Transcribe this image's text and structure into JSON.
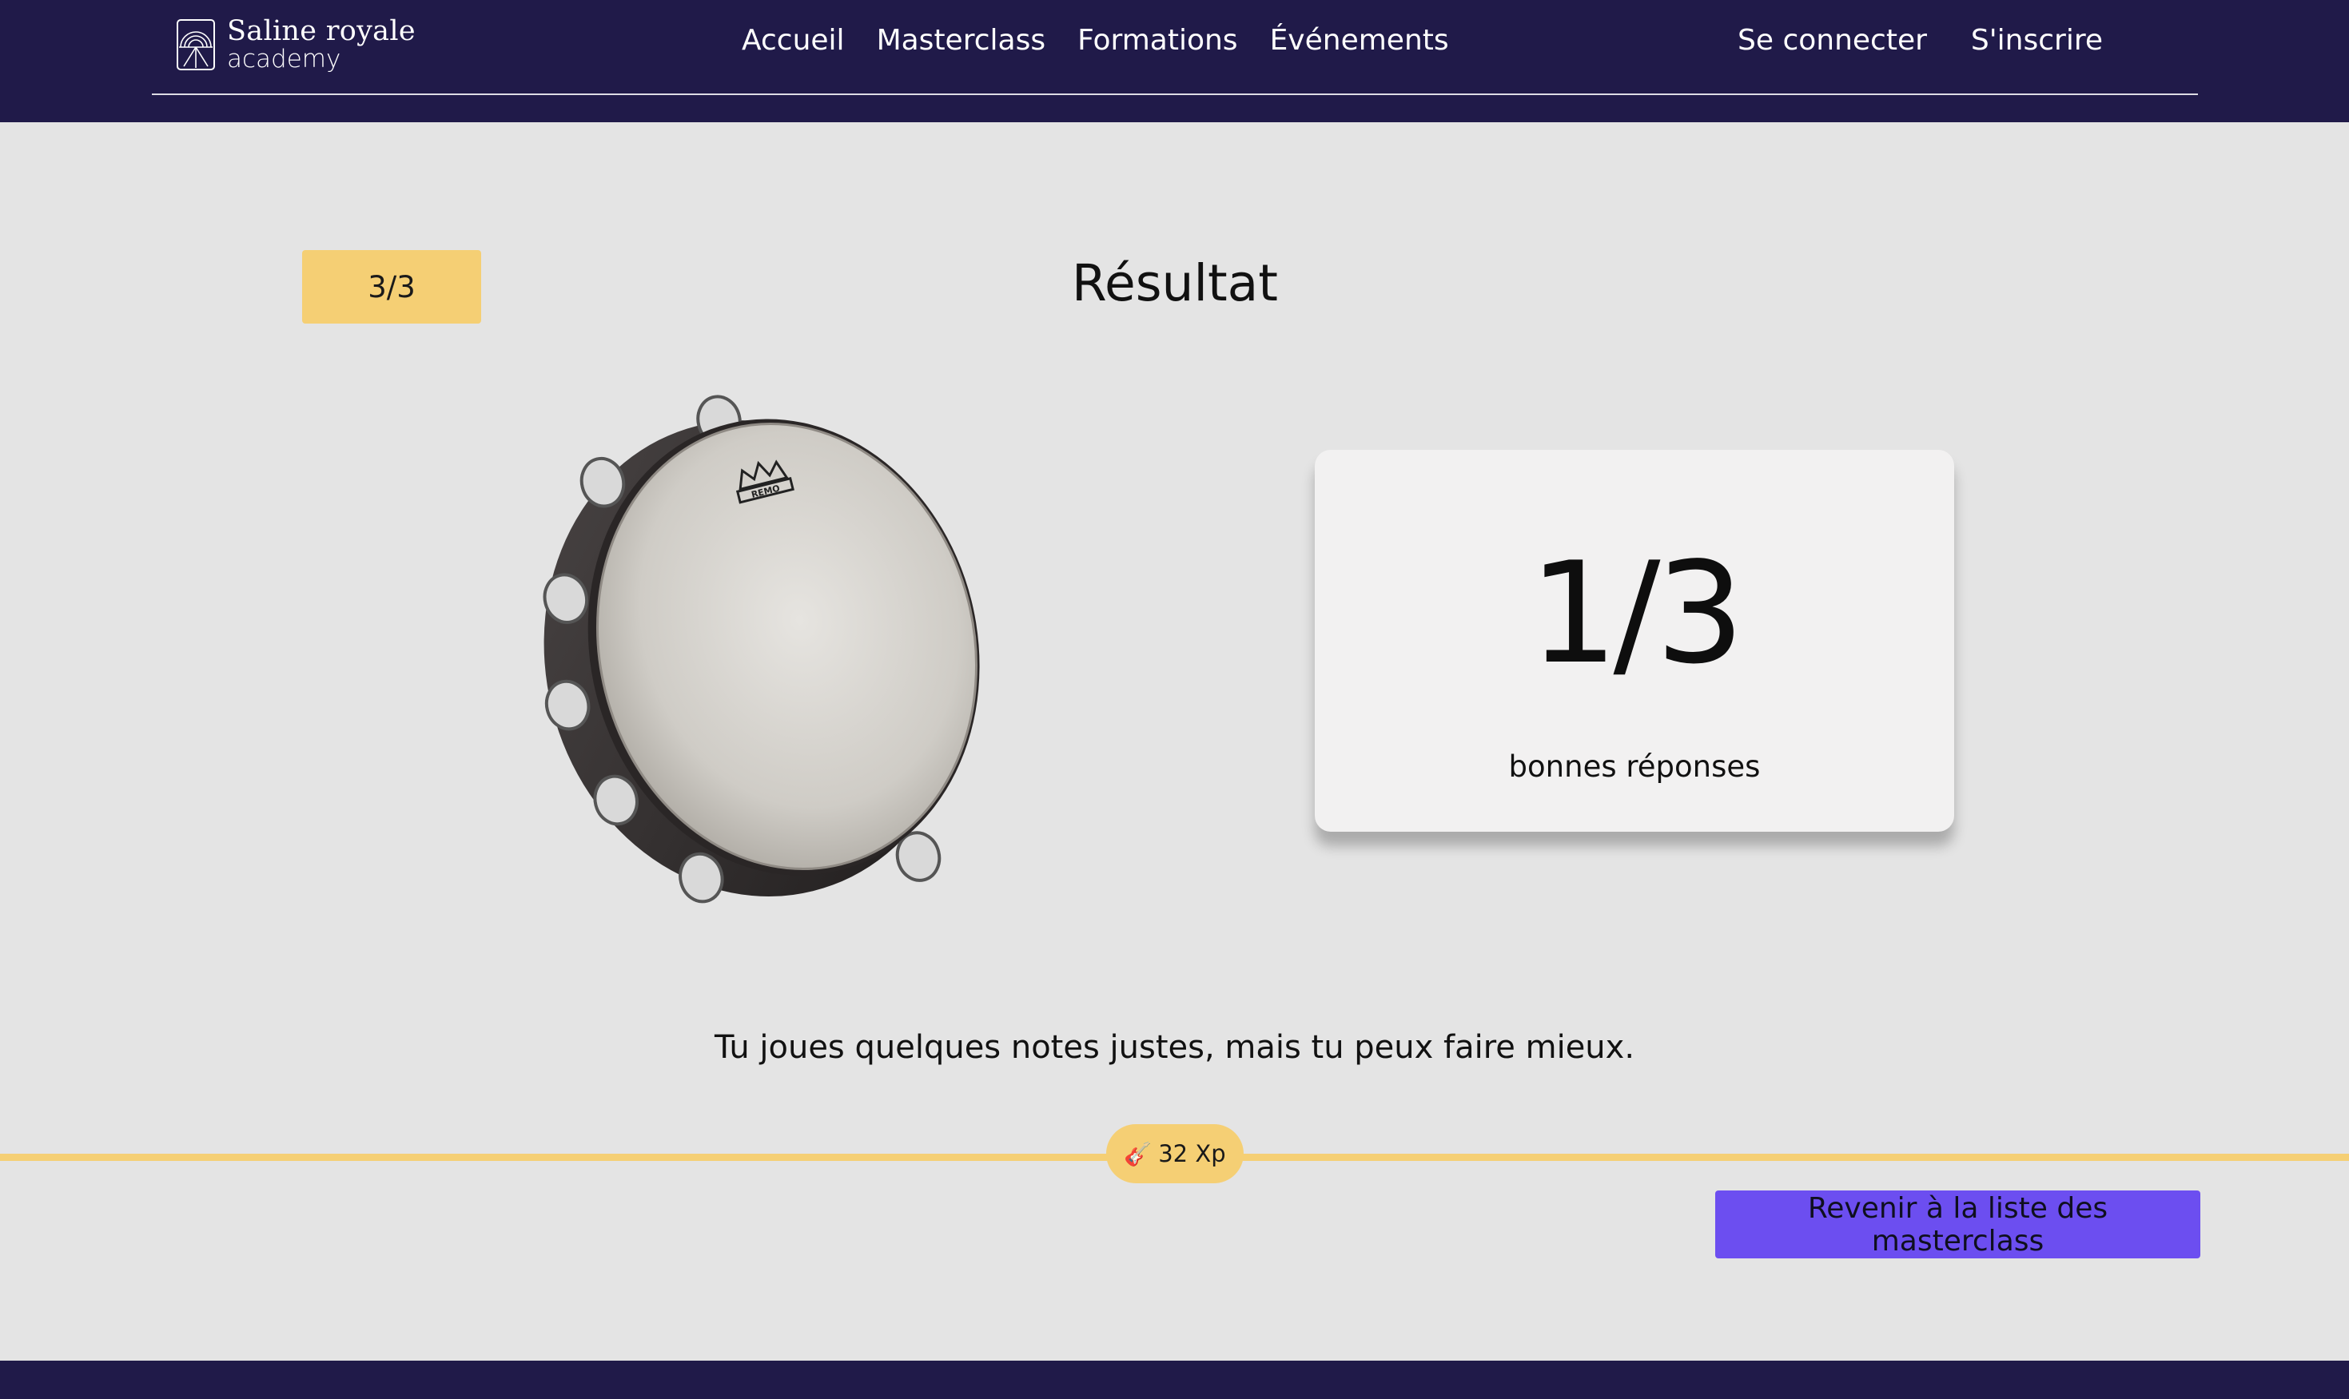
{
  "header": {
    "logo_line1": "Saline royale",
    "logo_line2": "academy",
    "nav": [
      "Accueil",
      "Masterclass",
      "Formations",
      "Événements"
    ],
    "auth": {
      "login": "Se connecter",
      "signup": "S'inscrire"
    }
  },
  "quiz": {
    "progress": "3/3",
    "title": "Résultat",
    "image_subject": "tambourine-icon",
    "score": "1/3",
    "score_label": "bonnes réponses",
    "feedback": "Tu joues quelques notes justes, mais tu peux faire mieux.",
    "xp_icon": "guitar-icon",
    "xp": "32 Xp"
  },
  "actions": {
    "back_label": "Revenir à la liste des masterclass"
  },
  "colors": {
    "header_bg": "#201a49",
    "accent_yellow": "#f5cf74",
    "button_purple": "#6c4ef0",
    "page_bg": "#e4e4e4"
  }
}
